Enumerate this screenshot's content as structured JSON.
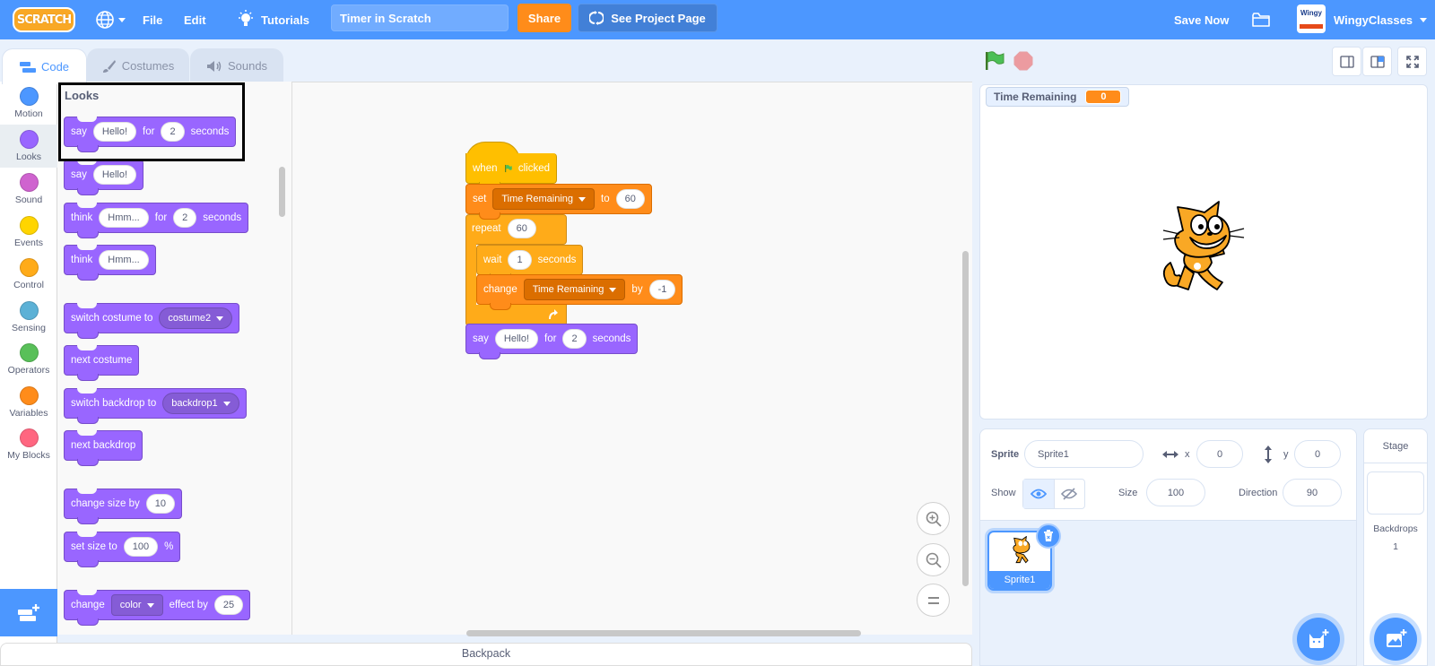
{
  "menubar": {
    "logo": "SCRATCH",
    "file": "File",
    "edit": "Edit",
    "tutorials": "Tutorials",
    "project_title": "Timer in Scratch",
    "share": "Share",
    "see_project_page": "See Project Page",
    "save_now": "Save Now",
    "username": "WingyClasses",
    "avatar_text": "Wingy"
  },
  "tabs": [
    {
      "label": "Code",
      "active": true
    },
    {
      "label": "Costumes",
      "active": false
    },
    {
      "label": "Sounds",
      "active": false
    }
  ],
  "categories": [
    {
      "label": "Motion",
      "color": "#4c97ff"
    },
    {
      "label": "Looks",
      "color": "#9966ff",
      "selected": true
    },
    {
      "label": "Sound",
      "color": "#cf63cf"
    },
    {
      "label": "Events",
      "color": "#ffd500"
    },
    {
      "label": "Control",
      "color": "#ffab19"
    },
    {
      "label": "Sensing",
      "color": "#5cb1d6"
    },
    {
      "label": "Operators",
      "color": "#59c059"
    },
    {
      "label": "Variables",
      "color": "#ff8c1a"
    },
    {
      "label": "My Blocks",
      "color": "#ff6680"
    }
  ],
  "palette": {
    "title": "Looks",
    "blocks": {
      "say_for": {
        "say": "say",
        "msg": "Hello!",
        "for": "for",
        "secs": "2",
        "seconds": "seconds"
      },
      "say": {
        "say": "say",
        "msg": "Hello!"
      },
      "think_for": {
        "think": "think",
        "msg": "Hmm...",
        "for": "for",
        "secs": "2",
        "seconds": "seconds"
      },
      "think": {
        "think": "think",
        "msg": "Hmm..."
      },
      "switch_costume": {
        "label": "switch costume to",
        "value": "costume2"
      },
      "next_costume": "next costume",
      "switch_backdrop": {
        "label": "switch backdrop to",
        "value": "backdrop1"
      },
      "next_backdrop": "next backdrop",
      "change_size": {
        "label": "change size by",
        "value": "10"
      },
      "set_size": {
        "label": "set size to",
        "value": "100",
        "unit": "%"
      },
      "change_effect": {
        "change": "change",
        "effect": "color",
        "by": "effect by",
        "value": "25"
      }
    }
  },
  "script": {
    "when": "when",
    "clicked": "clicked",
    "set": "set",
    "set_var": "Time Remaining",
    "to": "to",
    "set_value": "60",
    "repeat": "repeat",
    "repeat_count": "60",
    "wait": "wait",
    "wait_value": "1",
    "wait_seconds": "seconds",
    "change": "change",
    "change_var": "Time Remaining",
    "by": "by",
    "change_value": "-1",
    "say": "say",
    "say_msg": "Hello!",
    "say_for": "for",
    "say_secs": "2",
    "say_seconds": "seconds"
  },
  "backpack": "Backpack",
  "stage": {
    "monitor_label": "Time Remaining",
    "monitor_value": "0"
  },
  "sprite_info": {
    "sprite_label": "Sprite",
    "sprite_name": "Sprite1",
    "x_label": "x",
    "x_value": "0",
    "y_label": "y",
    "y_value": "0",
    "show_label": "Show",
    "size_label": "Size",
    "size_value": "100",
    "direction_label": "Direction",
    "direction_value": "90"
  },
  "sprites": [
    {
      "name": "Sprite1",
      "selected": true
    }
  ],
  "stage_pane": {
    "title": "Stage",
    "backdrops_label": "Backdrops",
    "backdrops_count": "1"
  }
}
